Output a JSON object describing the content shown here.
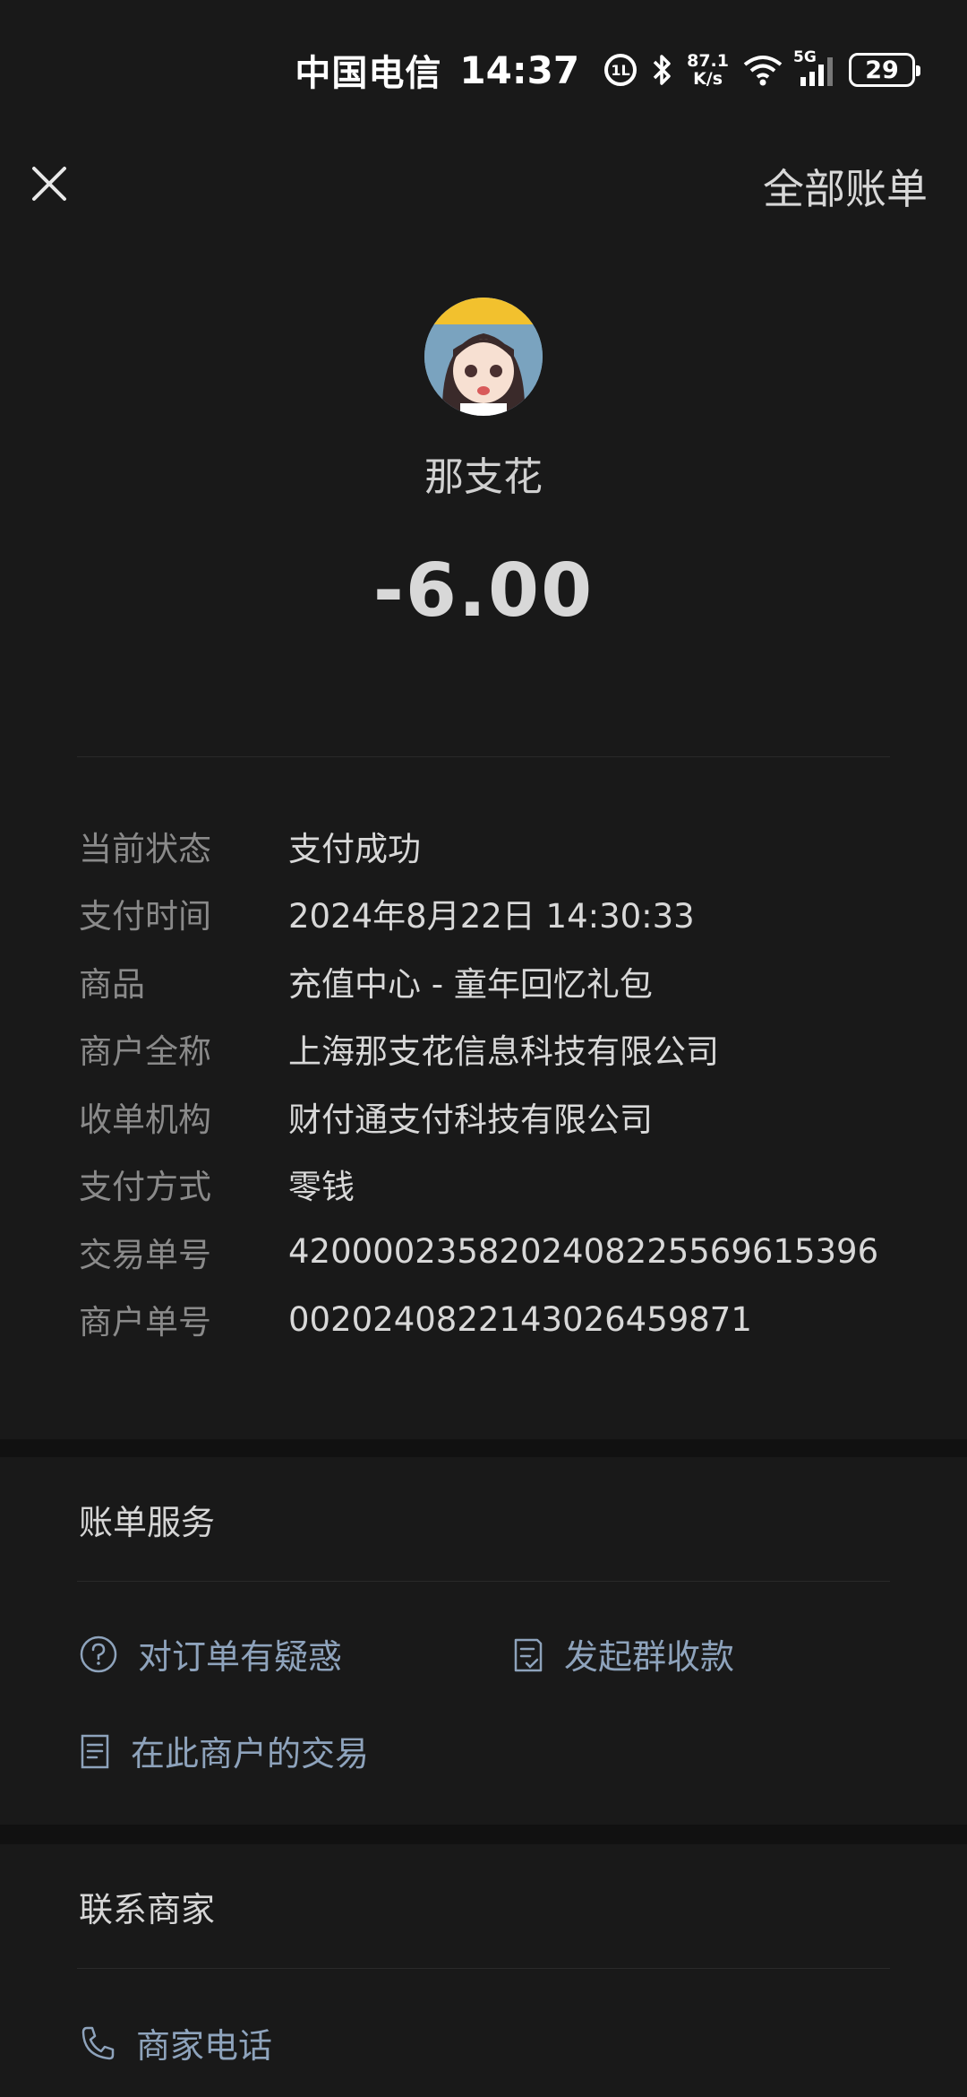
{
  "status_bar": {
    "carrier": "中国电信",
    "time": "14:37",
    "net_speed_value": "87.1",
    "net_speed_unit": "K/s",
    "signal_label": "5G",
    "battery": "29"
  },
  "header": {
    "all_bills": "全部账单"
  },
  "merchant": {
    "name": "那支花",
    "amount": "-6.00"
  },
  "details": [
    {
      "label": "当前状态",
      "value": "支付成功"
    },
    {
      "label": "支付时间",
      "value": "2024年8月22日 14:30:33"
    },
    {
      "label": "商品",
      "value": "充值中心 - 童年回忆礼包"
    },
    {
      "label": "商户全称",
      "value": "上海那支花信息科技有限公司"
    },
    {
      "label": "收单机构",
      "value": "财付通支付科技有限公司"
    },
    {
      "label": "支付方式",
      "value": "零钱"
    },
    {
      "label": "交易单号",
      "value": "4200002358202408225569615396"
    },
    {
      "label": "商户单号",
      "value": "0020240822143026459871"
    }
  ],
  "bill_service": {
    "title": "账单服务",
    "question_order": "对订单有疑惑",
    "group_collect": "发起群收款",
    "merchant_transactions": "在此商户的交易"
  },
  "contact": {
    "title": "联系商家",
    "merchant_phone": "商家电话"
  },
  "colors": {
    "background": "#191919",
    "band": "#111111",
    "link": "#8ea3bc",
    "label": "#8a8a8a"
  }
}
